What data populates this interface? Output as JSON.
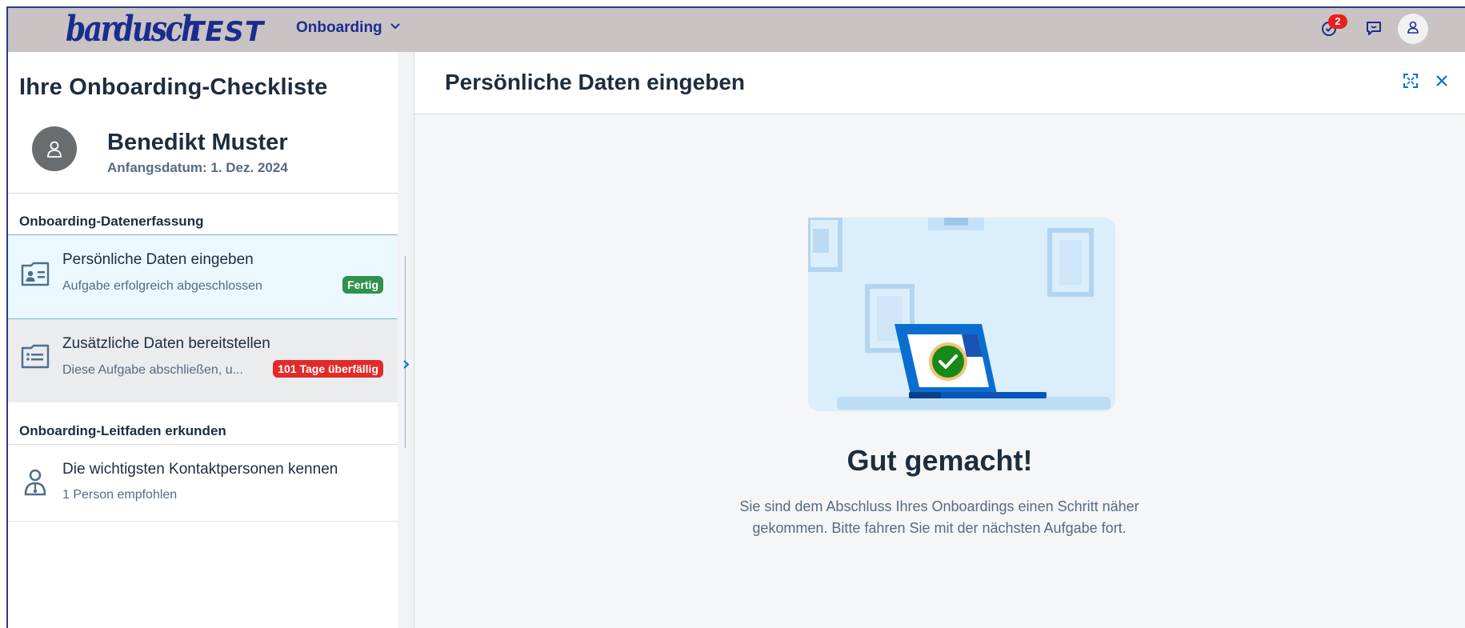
{
  "shell": {
    "logo_brand": "bardusch",
    "logo_env": "TEST",
    "app_menu_label": "Onboarding",
    "notifications_count": "2"
  },
  "left": {
    "title": "Ihre Onboarding-Checkliste",
    "profile": {
      "name": "Benedikt Muster",
      "start_date": "Anfangsdatum: 1. Dez. 2024"
    },
    "sections": [
      {
        "title": "Onboarding-Datenerfassung",
        "items": [
          {
            "title": "Persönliche Daten eingeben",
            "subtitle": "Aufgabe erfolgreich abgeschlossen",
            "tag": "Fertig",
            "icon": "contact-card-icon"
          },
          {
            "title": "Zusätzliche Daten bereitstellen",
            "subtitle": "Diese Aufgabe abschließen, u...",
            "tag": "101 Tage überfällig",
            "icon": "folder-list-icon"
          }
        ]
      },
      {
        "title": "Onboarding-Leitfaden erkunden",
        "items": [
          {
            "title": "Die wichtigsten Kontaktpersonen kennen",
            "subtitle": "1 Person empfohlen",
            "icon": "contact-person-icon"
          }
        ]
      }
    ]
  },
  "right": {
    "title": "Persönliche Daten eingeben",
    "done_title": "Gut gemacht!",
    "done_text": "Sie sind dem Abschluss Ihres Onboardings einen Schritt näher gekommen. Bitte fahren Sie mit der nächsten Aufgabe fort."
  },
  "colors": {
    "shell_bg": "#c9c3c3",
    "brand": "#1b2c8f",
    "success": "#30914c",
    "error": "#e32a2a",
    "selected_bg": "#ebf8ff",
    "accent": "#0a6ed1"
  }
}
